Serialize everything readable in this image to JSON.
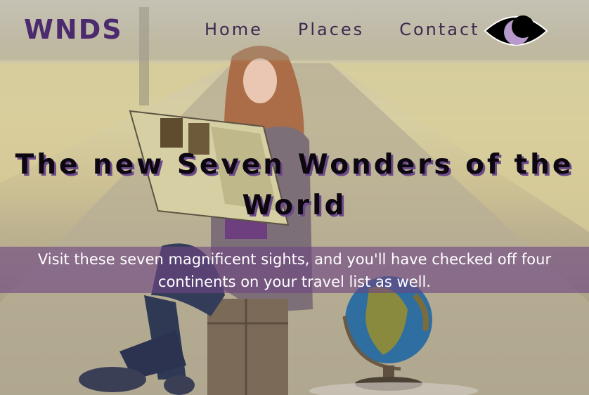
{
  "brand": "WNDS",
  "nav": {
    "items": [
      {
        "label": "Home"
      },
      {
        "label": "Places"
      },
      {
        "label": "Contact"
      }
    ]
  },
  "logo": {
    "icon": "moon-eye-icon"
  },
  "hero": {
    "headline": "The new Seven Wonders of the World",
    "subtitle": "Visit these seven magnificent sights, and you'll have checked off four continents on your travel list as well."
  },
  "colors": {
    "brand": "#4b2a6e",
    "subtitle_band": "#6e4682",
    "headline_shadow": "#6b4a8a"
  }
}
